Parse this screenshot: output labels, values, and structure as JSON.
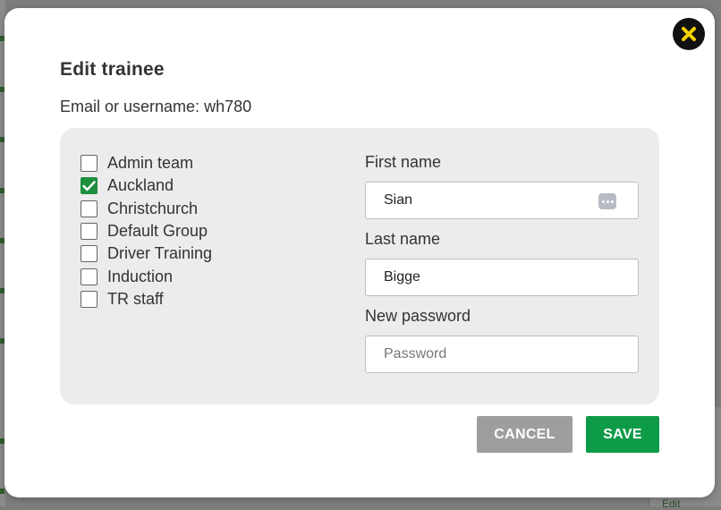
{
  "dialog": {
    "title": "Edit trainee",
    "email_label": "Email or username:",
    "email_value": "wh780",
    "close_icon": "close-icon",
    "accent_color": "#0e9b48",
    "close_icon_color": "#f5d300"
  },
  "groups": [
    {
      "label": "Admin team",
      "checked": false
    },
    {
      "label": "Auckland",
      "checked": true
    },
    {
      "label": "Christchurch",
      "checked": false
    },
    {
      "label": "Default Group",
      "checked": false
    },
    {
      "label": "Driver Training",
      "checked": false
    },
    {
      "label": "Induction",
      "checked": false
    },
    {
      "label": "TR staff",
      "checked": false
    }
  ],
  "form": {
    "first_name_label": "First name",
    "first_name_value": "Sian",
    "last_name_label": "Last name",
    "last_name_value": "Bigge",
    "password_label": "New password",
    "password_placeholder": "Password",
    "password_manager_icon": "password-manager-icon"
  },
  "actions": {
    "cancel_label": "CANCEL",
    "save_label": "SAVE"
  },
  "background": {
    "edit_link": "Edit"
  }
}
